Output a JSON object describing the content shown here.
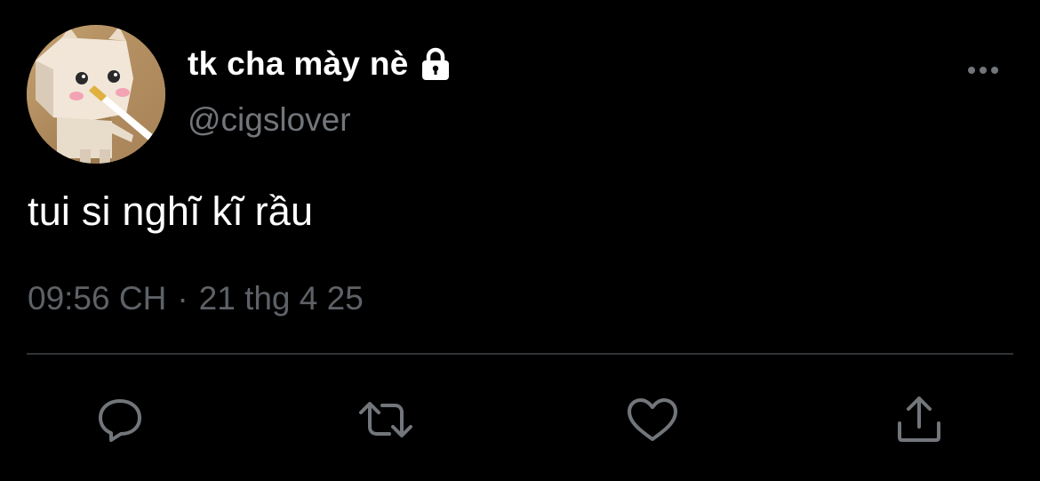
{
  "author": {
    "display_name": "tk cha mày nè",
    "handle": "@cigslover",
    "protected": true
  },
  "tweet": {
    "text": "tui si nghĩ kĩ rầu",
    "time": "09:56 CH",
    "separator": "·",
    "date": "21 thg 4 25"
  },
  "icons": {
    "lock": "lock-icon",
    "more": "more-horizontal-icon",
    "reply": "reply-bubble-icon",
    "retweet": "retweet-icon",
    "like": "heart-icon",
    "share": "share-upload-icon"
  },
  "colors": {
    "background": "#000000",
    "primary_text": "#ffffff",
    "secondary_text": "#72767b",
    "meta_text": "#5e6267",
    "icon": "#72767b",
    "divider": "#2f3336"
  }
}
